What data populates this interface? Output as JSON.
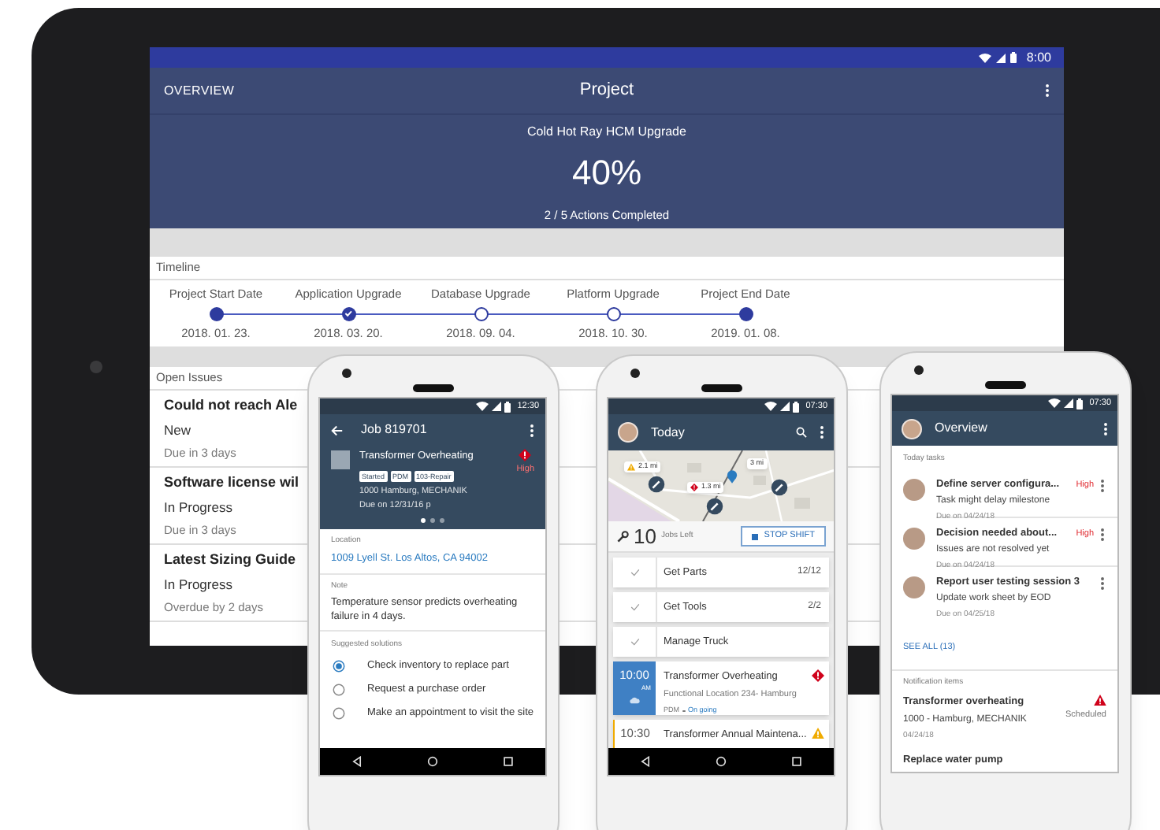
{
  "tablet": {
    "status_bar": {
      "time": "8:00"
    },
    "header": {
      "back_label": "OVERVIEW",
      "title": "Project"
    },
    "summary": {
      "project": "Cold Hot Ray HCM Upgrade",
      "percent": "40%",
      "actions": "2 / 5 Actions Completed"
    },
    "timeline": {
      "title": "Timeline",
      "milestones": [
        {
          "label": "Project Start Date",
          "date": "2018. 01. 23.",
          "kind": "filled"
        },
        {
          "label": "Application Upgrade",
          "date": "2018. 03. 20.",
          "kind": "completed"
        },
        {
          "label": "Database Upgrade",
          "date": "2018. 09. 04.",
          "kind": "open"
        },
        {
          "label": "Platform Upgrade",
          "date": "2018. 10. 30.",
          "kind": "open"
        },
        {
          "label": "Project End Date",
          "date": "2019. 01. 08.",
          "kind": "filled"
        }
      ]
    },
    "open_issues": {
      "title": "Open Issues",
      "items": [
        {
          "title": "Could not reach Ale",
          "status": "New",
          "due": "Due in 3 days"
        },
        {
          "title": "Software license wil",
          "status": "In Progress",
          "due": "Due in 3 days"
        },
        {
          "title": "Latest Sizing Guide",
          "status": "In Progress",
          "due": "Overdue by 2 days"
        }
      ]
    }
  },
  "phone_job": {
    "status_bar": {
      "time": "12:30"
    },
    "title": "Job 819701",
    "job": {
      "name": "Transformer Overheating",
      "tags": [
        "Started",
        "PDM",
        "103-Repair"
      ],
      "location": "1000 Hamburg, MECHANIK",
      "due": "Due on 12/31/16 p",
      "priority": "High"
    },
    "pages": [
      {
        "selected": true
      },
      {
        "selected": false
      },
      {
        "selected": false
      }
    ],
    "location": {
      "label": "Location",
      "address": "1009 Lyell St. Los Altos, CA 94002"
    },
    "note": {
      "label": "Note",
      "text": "Temperature sensor predicts overheating failure in 4 days."
    },
    "solutions": {
      "label": "Suggested solutions",
      "options": [
        {
          "label": "Check inventory to replace part",
          "selected": true
        },
        {
          "label": "Request a purchase order",
          "selected": false
        },
        {
          "label": "Make an appointment to visit the site",
          "selected": false
        }
      ]
    }
  },
  "phone_today": {
    "status_bar": {
      "time": "07:30"
    },
    "title": "Today",
    "map_markers": [
      {
        "kind": "warning",
        "distance": "2.1 mi"
      },
      {
        "kind": "critical",
        "distance": "1.3 mi"
      },
      {
        "kind": "plain",
        "distance": "3 mi"
      }
    ],
    "jobs": {
      "count": "10",
      "label": "Jobs Left"
    },
    "stop_button": "STOP SHIFT",
    "tasks": [
      {
        "label": "Get Parts",
        "count": "12/12",
        "done": true
      },
      {
        "label": "Get Tools",
        "count": "2/2",
        "done": true
      },
      {
        "label": "Manage Truck",
        "done": true
      }
    ],
    "appointments": [
      {
        "time": "10:00",
        "meridiem": "AM",
        "title": "Transformer Overheating",
        "subtitle": "Functional Location 234- Hamburg",
        "tag": "PDM",
        "status": "On going",
        "selected": true,
        "kind": "critical"
      },
      {
        "time": "10:30",
        "title": "Transformer Annual Maintena...",
        "selected": false,
        "kind": "warning"
      }
    ]
  },
  "phone_overview": {
    "status_bar": {
      "time": "07:30"
    },
    "title": "Overview",
    "tasks_label": "Today tasks",
    "tasks": [
      {
        "title": "Define server configura...",
        "subtitle": "Task might delay milestone",
        "due": "Due on 04/24/18",
        "priority": "High"
      },
      {
        "title": "Decision needed about...",
        "subtitle": "Issues are not resolved yet",
        "due": "Due on 04/24/18",
        "priority": "High"
      },
      {
        "title": "Report user testing session 3",
        "subtitle": "Update work sheet by EOD",
        "due": "Due on 04/25/18"
      }
    ],
    "see_all": "SEE ALL (13)",
    "notifications_label": "Notification items",
    "notifications": [
      {
        "title": "Transformer overheating",
        "subtitle": "1000 - Hamburg, MECHANIK",
        "date": "04/24/18",
        "status": "Scheduled",
        "kind": "error"
      },
      {
        "title": "Replace water pump",
        "kind": "plain"
      }
    ]
  }
}
